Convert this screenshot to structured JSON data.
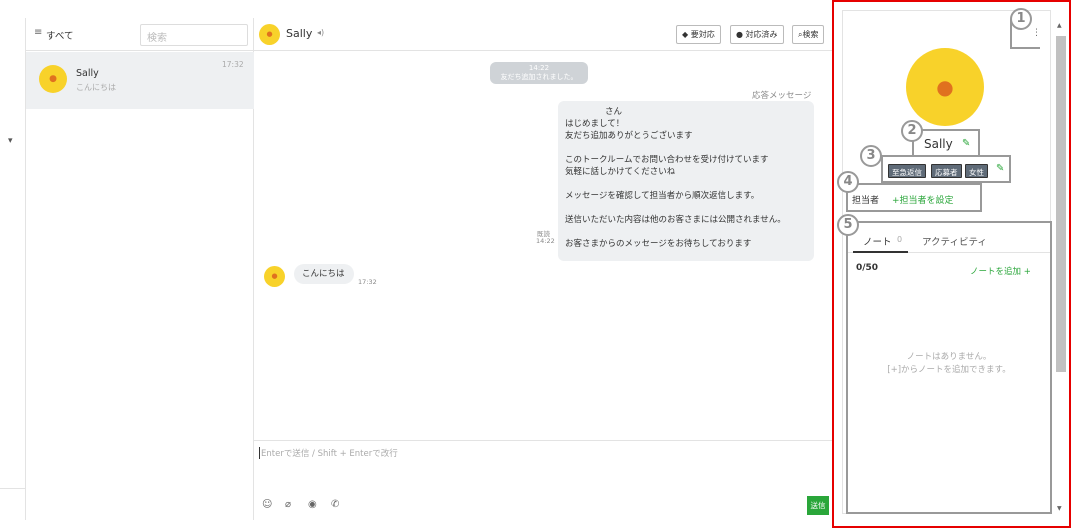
{
  "sidebar_filter": {
    "label": "すべて",
    "search_placeholder": "検索"
  },
  "conversation_item": {
    "name": "Sally",
    "preview": "こんにちは",
    "time": "17:32"
  },
  "chat_header": {
    "name": "Sally",
    "btn_unhandled": "要対応",
    "btn_handled": "対応済み",
    "btn_search": "検索"
  },
  "messages": {
    "system_time": "14:22",
    "system_text": "友だち追加されました。",
    "auto_reply_label": "応答メッセージ",
    "auto_reply_lines": [
      "さん",
      "はじめまして！",
      "友だち追加ありがとうございます",
      "",
      "このトークルームでお問い合わせを受け付けています",
      "気軽に話しかけてくださいね",
      "",
      "メッセージを確認して担当者から順次返信します。",
      "",
      "送信いただいた内容は他のお客さまには公開されません。",
      "",
      "お客さまからのメッセージをお待ちしております"
    ],
    "read_status": "既読",
    "read_time": "14:22",
    "user_message": "こんにちは",
    "user_time": "17:32"
  },
  "composer": {
    "placeholder": "Enterで送信 / Shift + Enterで改行",
    "send_label": "送信"
  },
  "profile": {
    "name": "Sally",
    "tags": [
      "至急返信",
      "応募者",
      "女性"
    ],
    "assignee_label": "担当者",
    "assign_link": "+担当者を設定",
    "tabs": [
      {
        "label": "ノート",
        "count": "0"
      },
      {
        "label": "アクティビティ"
      }
    ],
    "note_count": "0/50",
    "add_note": "ノートを追加 +",
    "empty_line1": "ノートはありません。",
    "empty_line2": "[+]からノートを追加できます。"
  },
  "callouts": [
    "1",
    "2",
    "3",
    "4",
    "5"
  ],
  "colors": {
    "highlight": "#e60000",
    "send": "#2aa63a",
    "avatar": "#f8d22a"
  }
}
